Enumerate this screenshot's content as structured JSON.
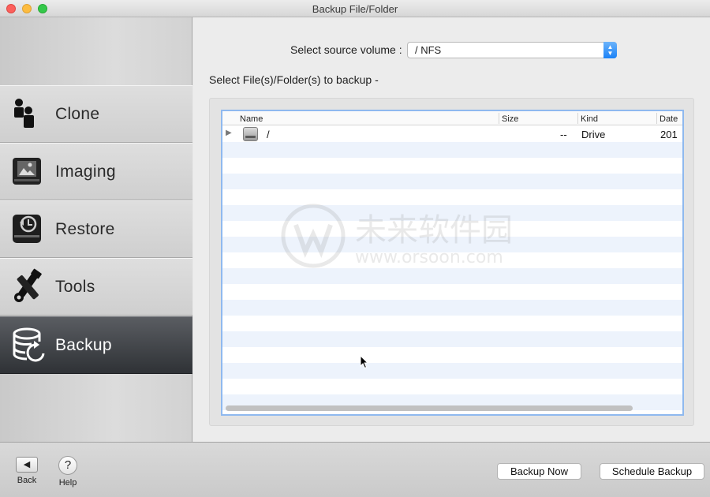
{
  "window": {
    "title": "Backup File/Folder"
  },
  "sidebar": {
    "items": [
      {
        "label": "Clone",
        "icon": "clone-icon",
        "active": false
      },
      {
        "label": "Imaging",
        "icon": "imaging-icon",
        "active": false
      },
      {
        "label": "Restore",
        "icon": "restore-icon",
        "active": false
      },
      {
        "label": "Tools",
        "icon": "tools-icon",
        "active": false
      },
      {
        "label": "Backup",
        "icon": "backup-icon",
        "active": true
      }
    ]
  },
  "main": {
    "source_label": "Select source volume :",
    "source_value": "/ NFS",
    "select_label": "Select File(s)/Folder(s) to backup -",
    "table": {
      "columns": [
        "Name",
        "Size",
        "Kind",
        "Date"
      ],
      "rows": [
        {
          "name": "/",
          "size": "--",
          "kind": "Drive",
          "date": "201"
        }
      ]
    }
  },
  "watermark": {
    "text": "未来软件园",
    "url": "www.orsoon.com"
  },
  "bottom": {
    "back_label": "Back",
    "help_label": "Help",
    "backup_now_label": "Backup Now",
    "schedule_label": "Schedule Backup"
  },
  "colors": {
    "accent": "#1a82f7",
    "active_sidebar": "#3a3d42",
    "selection_border": "#8fb9ef",
    "stripe": "#edf3fc"
  }
}
